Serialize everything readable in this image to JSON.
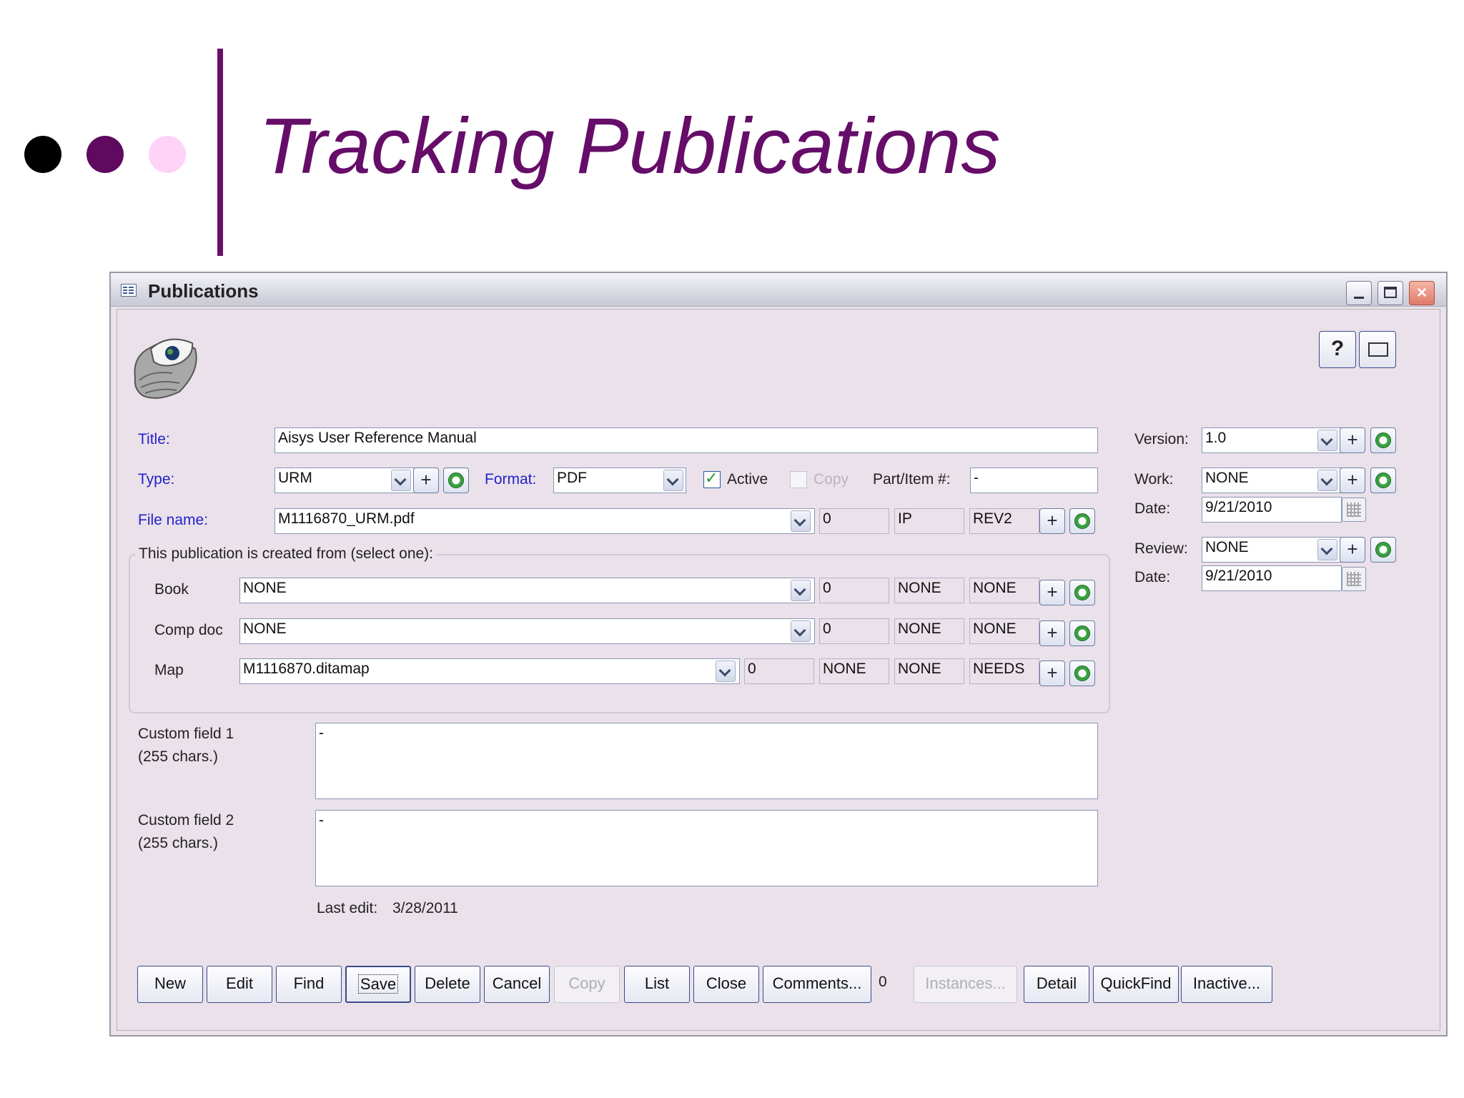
{
  "slide": {
    "title": "Tracking Publications"
  },
  "window": {
    "title": "Publications"
  },
  "form": {
    "title_label": "Title:",
    "title_value": "Aisys User Reference Manual",
    "type_label": "Type:",
    "type_value": "URM",
    "format_label": "Format:",
    "format_value": "PDF",
    "active_label": "Active",
    "copy_label": "Copy",
    "part_label": "Part/Item #:",
    "part_value": "-",
    "filename_label": "File name:",
    "filename_value": "M1116870_URM.pdf",
    "filename_ro": [
      "0",
      "IP",
      "REV2"
    ],
    "version_label": "Version:",
    "version_value": "1.0",
    "work_label": "Work:",
    "work_value": "NONE",
    "work_date_label": "Date:",
    "work_date_value": "9/21/2010",
    "review_label": "Review:",
    "review_value": "NONE",
    "review_date_label": "Date:",
    "review_date_value": "9/21/2010",
    "source_group_label": "This publication is created from (select one):",
    "book_label": "Book",
    "book_value": "NONE",
    "book_ro": [
      "0",
      "NONE",
      "NONE"
    ],
    "compdoc_label": "Comp doc",
    "compdoc_value": "NONE",
    "compdoc_ro": [
      "0",
      "NONE",
      "NONE"
    ],
    "map_label": "Map",
    "map_value": "M1116870.ditamap",
    "map_ro": [
      "0",
      "NONE",
      "NONE",
      "NEEDS"
    ],
    "custom1_label1": "Custom field 1",
    "custom1_label2": "(255 chars.)",
    "custom1_value": "-",
    "custom2_label1": "Custom field 2",
    "custom2_label2": "(255 chars.)",
    "custom2_value": "-",
    "last_edit_label": "Last edit:",
    "last_edit_value": "3/28/2011"
  },
  "buttons": {
    "new": "New",
    "edit": "Edit",
    "find": "Find",
    "save": "Save",
    "delete": "Delete",
    "cancel": "Cancel",
    "copy": "Copy",
    "list": "List",
    "close": "Close",
    "comments": "Comments...",
    "comments_count": "0",
    "instances": "Instances...",
    "detail": "Detail",
    "quickfind": "QuickFind",
    "inactive": "Inactive..."
  },
  "help_button_glyph": "?",
  "icons": [
    "oyster-logo-icon",
    "help-icon",
    "mail-icon",
    "dropdown-arrow-icon",
    "plus-icon",
    "refresh-icon",
    "calendar-icon"
  ]
}
